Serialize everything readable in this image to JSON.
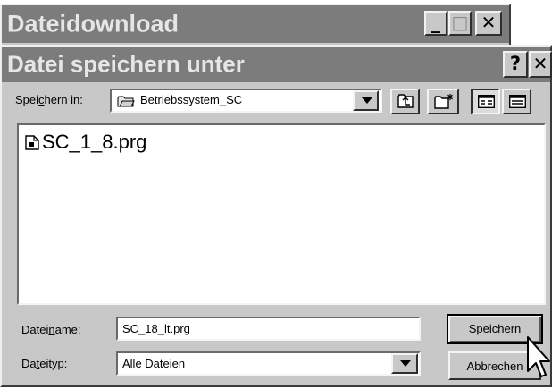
{
  "back_window": {
    "title": "Dateidownload",
    "minimize_glyph": "_",
    "maximize_glyph": "□",
    "close_glyph": "✕"
  },
  "dialog": {
    "title": "Datei speichern unter",
    "help_glyph": "?",
    "close_glyph": "✕",
    "save_in": {
      "label_pre": "Spei",
      "label_key": "c",
      "label_post": "hern in:",
      "value": "Betriebssystem_SC",
      "icon": "folder-icon"
    },
    "toolbar": {
      "up_icon": "up-one-level-icon",
      "new_folder_icon": "new-folder-icon",
      "list_icon": "list-view-icon",
      "details_icon": "details-view-icon"
    },
    "files": [
      {
        "name": "SC_1_8.prg",
        "icon": "file-icon"
      }
    ],
    "filename": {
      "label_pre": "Datei",
      "label_key": "n",
      "label_post": "ame:",
      "value": "SC_18_lt.prg"
    },
    "filetype": {
      "label_pre": "Da",
      "label_key": "t",
      "label_post": "eityp:",
      "value": "Alle Dateien"
    },
    "buttons": {
      "save_key": "S",
      "save_rest": "peichern",
      "cancel": "Abbrechen"
    }
  },
  "colors": {
    "face": "#c8c8c8",
    "titlebar": "#7c7c7c",
    "title_text": "#e6e6e6"
  }
}
